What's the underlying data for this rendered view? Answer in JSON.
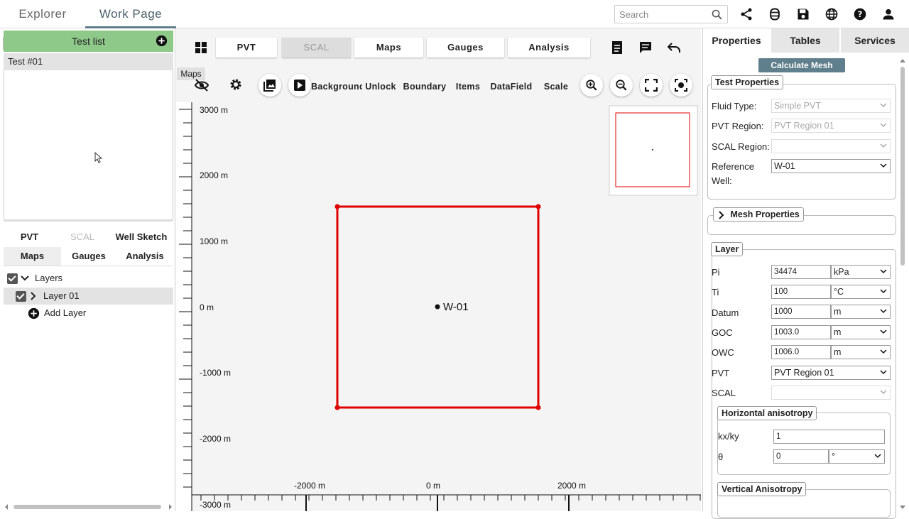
{
  "top_tabs": {
    "explorer": "Explorer",
    "work_page": "Work Page"
  },
  "search": {
    "placeholder": "Search"
  },
  "left": {
    "test_list_header": "Test list",
    "tests": [
      "Test #01"
    ],
    "tabs_row1": [
      "PVT",
      "SCAL",
      "Well Sketch"
    ],
    "tabs_row2": [
      "Maps",
      "Gauges",
      "Analysis"
    ],
    "tree": {
      "layers": "Layers",
      "layer_01": "Layer 01",
      "add_layer": "Add Layer"
    }
  },
  "center": {
    "tabs": [
      "PVT",
      "SCAL",
      "Maps",
      "Gauges",
      "Analysis"
    ],
    "maps_label": "Maps",
    "tools": {
      "background": "Background",
      "unlock": "Unlock",
      "boundary": "Boundary",
      "items": "Items",
      "datafield": "DataField",
      "scale": "Scale"
    },
    "plot": {
      "y_ticks": [
        "3000 m",
        "2000 m",
        "1000 m",
        "0 m",
        "-1000 m",
        "-2000 m",
        "-3000 m"
      ],
      "x_ticks": [
        "-2000 m",
        "0 m",
        "2000 m"
      ],
      "well_label": "W-01",
      "boundary_color": "#e00000"
    }
  },
  "right": {
    "tabs": [
      "Properties",
      "Tables",
      "Services"
    ],
    "calculate_mesh": "Calculate Mesh",
    "test_properties": {
      "title": "Test Properties",
      "fluid_type_label": "Fluid Type:",
      "fluid_type_value": "Simple PVT",
      "pvt_region_label": "PVT Region:",
      "pvt_region_value": "PVT Region 01",
      "scal_region_label": "SCAL Region:",
      "scal_region_value": "",
      "reference_well_label_1": "Reference",
      "reference_well_label_2": "Well:",
      "reference_well_value": "W-01"
    },
    "mesh_properties": "Mesh Properties",
    "layer": {
      "title": "Layer",
      "pi_label": "Pi",
      "pi_value": "34474",
      "pi_unit": "kPa",
      "ti_label": "Ti",
      "ti_value": "100",
      "ti_unit": "°C",
      "datum_label": "Datum",
      "datum_value": "1000",
      "datum_unit": "m",
      "goc_label": "GOC",
      "goc_value": "1003.0",
      "goc_unit": "m",
      "owc_label": "OWC",
      "owc_value": "1006.0",
      "owc_unit": "m",
      "pvt_label": "PVT",
      "pvt_value": "PVT Region 01",
      "scal_label": "SCAL",
      "scal_value": ""
    },
    "horizontal_anisotropy": {
      "title": "Horizontal anisotropy",
      "kxky_label": "kx/ky",
      "kxky_value": "1",
      "theta_label": "θ",
      "theta_value": "0",
      "theta_unit": "°"
    },
    "vertical_anisotropy": {
      "title": "Vertical Anisotropy"
    }
  }
}
